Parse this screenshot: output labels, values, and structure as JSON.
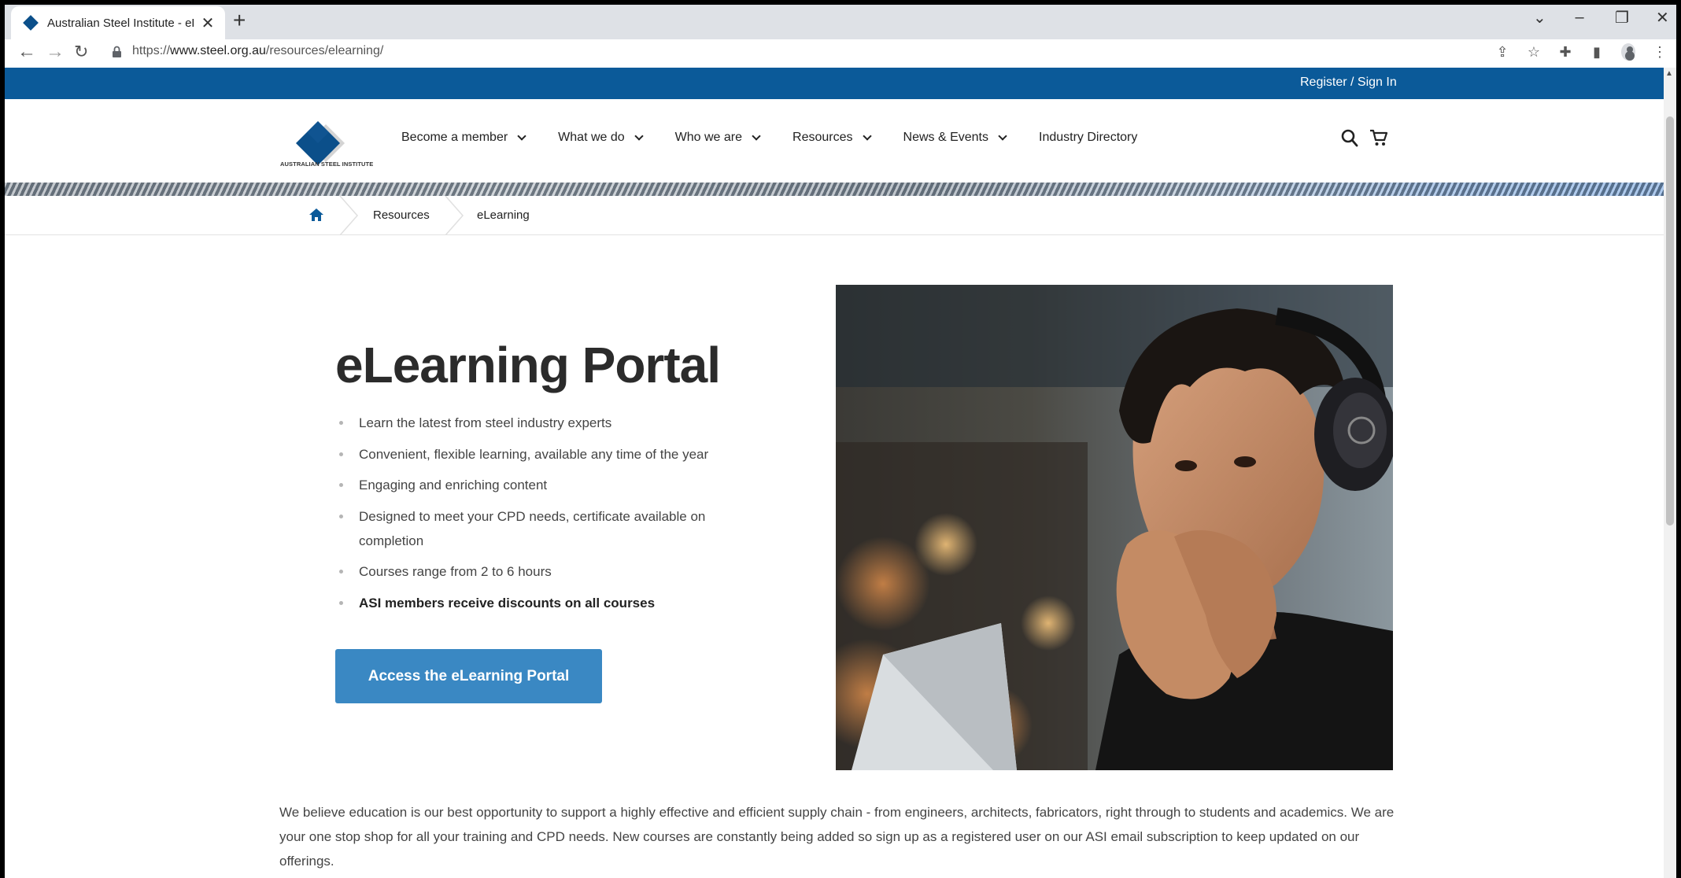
{
  "browser": {
    "tab_title": "Australian Steel Institute - eLearni",
    "tab_close": "✕",
    "new_tab": "+",
    "url_prefix": "https://",
    "url_domain": "www.steel.org.au",
    "url_path": "/resources/elearning/"
  },
  "site": {
    "register_link": "Register / Sign In",
    "logo_text": "AUSTRALIAN STEEL INSTITUTE",
    "nav": [
      {
        "label": "Become a member"
      },
      {
        "label": "What we do"
      },
      {
        "label": "Who we are"
      },
      {
        "label": "Resources"
      },
      {
        "label": "News & Events"
      },
      {
        "label": "Industry Directory"
      }
    ],
    "brand_color": "#0b5a99",
    "accent_color": "#3a88c3"
  },
  "breadcrumb": {
    "items": [
      "Resources",
      "eLearning"
    ]
  },
  "main": {
    "title": "eLearning Portal",
    "bullets": [
      "Learn the latest from steel industry experts",
      "Convenient, flexible learning, available any time of the year",
      "Engaging and enriching content",
      "Designed to meet your CPD needs, certificate available on completion",
      "Courses range from 2 to 6 hours",
      "ASI members receive discounts on all courses"
    ],
    "cta_label": "Access the eLearning Portal",
    "intro": "We believe education is our best opportunity to support a highly effective and efficient supply chain - from engineers, architects, fabricators, right through to students and academics. We are your one stop shop for all your training and CPD needs.  New courses are constantly being added so sign up as a registered user on our ASI email subscription to keep updated on our offerings."
  },
  "icons": {
    "back": "back-arrow-icon",
    "forward": "forward-arrow-icon",
    "reload": "reload-icon",
    "home": "home-icon",
    "search": "search-icon",
    "cart": "cart-icon"
  }
}
